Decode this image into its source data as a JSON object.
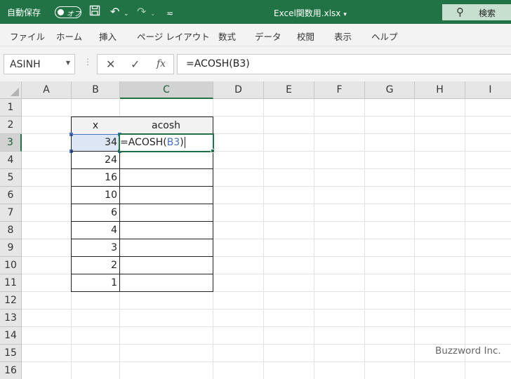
{
  "titlebar": {
    "autosave_label": "自動保存",
    "autosave_state": "オフ",
    "document_title": "Excel関数用.xlsx",
    "search_label": "検索"
  },
  "menu": {
    "items": [
      "ファイル",
      "ホーム",
      "挿入",
      "ページ レイアウト",
      "数式",
      "データ",
      "校閲",
      "表示",
      "ヘルプ"
    ]
  },
  "formula_bar": {
    "name_box": "ASINH",
    "formula": "=ACOSH(B3)"
  },
  "grid": {
    "columns": [
      "A",
      "B",
      "C",
      "D",
      "E",
      "F",
      "G",
      "H",
      "I"
    ],
    "rows": [
      "1",
      "2",
      "3",
      "4",
      "5",
      "6",
      "7",
      "8",
      "9",
      "10",
      "11",
      "12",
      "13",
      "14",
      "15",
      "16"
    ],
    "selected_column": "C",
    "selected_row": "3",
    "table_headers": [
      "x",
      "acosh"
    ],
    "x_values": [
      "34",
      "24",
      "16",
      "10",
      "6",
      "4",
      "3",
      "2",
      "1"
    ],
    "editing": {
      "prefix": "=ACOSH(",
      "ref": "B3",
      "suffix": ")"
    }
  },
  "watermark": "Buzzword Inc."
}
